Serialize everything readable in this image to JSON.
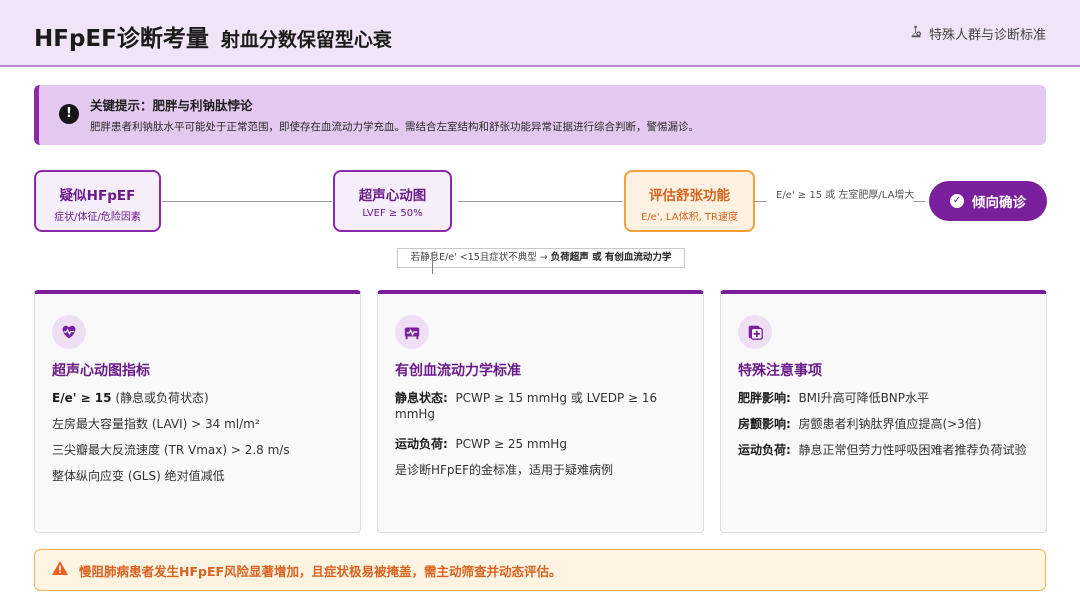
{
  "header": {
    "title": "HFpEF诊断考量",
    "subtitle": "射血分数保留型心衰",
    "link_label": "特殊人群与诊断标准"
  },
  "tip": {
    "title": "关键提示：肥胖与利钠肽悖论",
    "text": "肥胖患者利钠肽水平可能处于正常范围，即使存在血流动力学充血。需结合左室结构和舒张功能异常证据进行综合判断，警惕漏诊。"
  },
  "flow": {
    "nodes": [
      {
        "title": "疑似HFpEF",
        "sub": "症状/体征/危险因素"
      },
      {
        "title": "超声心动图",
        "sub": "LVEF ≥ 50%"
      },
      {
        "title": "评估舒张功能",
        "sub": "E/e', LA体积, TR速度"
      }
    ],
    "condition_label": "E/e' ≥ 15 或 左室肥厚/LA增大",
    "confirm_label": "倾向确诊",
    "branch": {
      "prefix": "若静息E/e' <15且症状不典型 → ",
      "emphasis": "负荷超声 或 有创血流动力学"
    }
  },
  "cards": [
    {
      "icon": "heart-pulse-icon",
      "title": "超声心动图指标",
      "rows": [
        {
          "label": "E/e' ≥ 15",
          "text": " (静息或负荷状态)"
        },
        {
          "label": "",
          "text": "左房最大容量指数 (LAVI) > 34 ml/m²"
        },
        {
          "label": "",
          "text": "三尖瓣最大反流速度 (TR Vmax) > 2.8 m/s"
        },
        {
          "label": "",
          "text": "整体纵向应变 (GLS) 绝对值减低"
        }
      ]
    },
    {
      "icon": "bed-monitor-icon",
      "title": "有创血流动力学标准",
      "rows": [
        {
          "label": "静息状态:",
          "text": "  PCWP ≥ 15 mmHg 或 LVEDP ≥ 16 mmHg"
        },
        {
          "label": "运动负荷:",
          "text": "  PCWP ≥ 25 mmHg"
        },
        {
          "label": "",
          "text": "是诊断HFpEF的金标准，适用于疑难病例"
        }
      ]
    },
    {
      "icon": "medical-notes-icon",
      "title": "特殊注意事项",
      "rows": [
        {
          "label": "肥胖影响:",
          "text": "  BMI升高可降低BNP水平"
        },
        {
          "label": "房颤影响:",
          "text": "  房颤患者利钠肽界值应提高(>3倍)"
        },
        {
          "label": "运动负荷:",
          "text": "  静息正常但劳力性呼吸困难者推荐负荷试验"
        }
      ]
    }
  ],
  "warning": {
    "text": "慢阻肺病患者发生HFpEF风险显著增加，且症状极易被掩盖，需主动筛查并动态评估。"
  },
  "colors": {
    "accent": "#7a1f9c",
    "accent_light": "#f1e4f6",
    "warning": "#d9631e"
  }
}
